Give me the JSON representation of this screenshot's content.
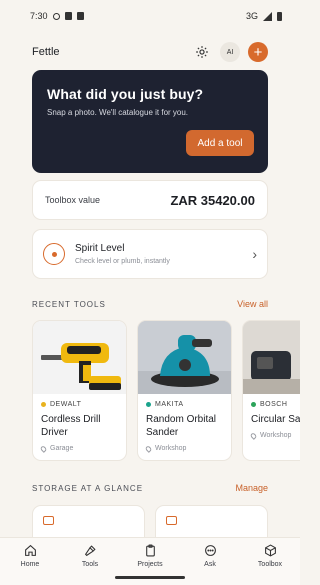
{
  "status_bar": {
    "time": "7:30",
    "network": "3G"
  },
  "header": {
    "app_name": "Fettle",
    "ai_label": "AI"
  },
  "hero": {
    "title": "What did you just buy?",
    "subtitle": "Snap a photo. We'll catalogue it for you.",
    "button": "Add a tool"
  },
  "toolbox_value": {
    "label": "Toolbox value",
    "value": "ZAR 35420.00"
  },
  "spirit_level": {
    "title": "Spirit Level",
    "subtitle": "Check level or plumb, instantly"
  },
  "recent_tools": {
    "heading": "RECENT TOOLS",
    "action": "View all",
    "items": [
      {
        "brand": "DEWALT",
        "brand_color": "#e8b21e",
        "name": "Cordless Drill Driver",
        "location": "Garage"
      },
      {
        "brand": "MAKITA",
        "brand_color": "#1aa38c",
        "name": "Random Orbital Sander",
        "location": "Workshop"
      },
      {
        "brand": "BOSCH",
        "brand_color": "#2ca35a",
        "name": "Circular Saw",
        "location": "Workshop"
      }
    ]
  },
  "storage": {
    "heading": "STORAGE AT A GLANCE",
    "action": "Manage"
  },
  "tabs": [
    {
      "label": "Home",
      "icon": "home-icon"
    },
    {
      "label": "Tools",
      "icon": "hammer-icon"
    },
    {
      "label": "Projects",
      "icon": "clipboard-icon"
    },
    {
      "label": "Ask",
      "icon": "chat-icon"
    },
    {
      "label": "Toolbox",
      "icon": "box-icon"
    }
  ],
  "colors": {
    "accent": "#d86a2c",
    "hero_bg": "#1e2231",
    "page_bg": "#f7f4ef"
  }
}
